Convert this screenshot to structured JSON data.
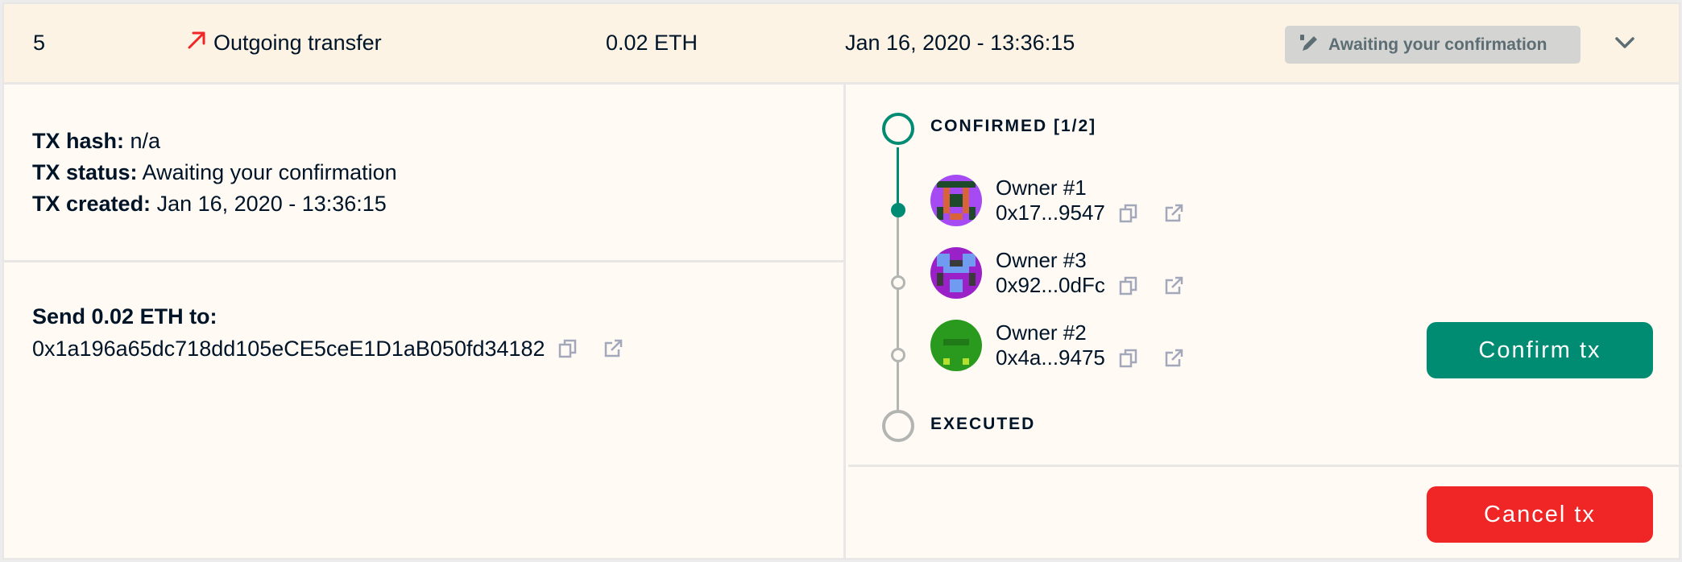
{
  "row": {
    "nonce": "5",
    "type_label": "Outgoing transfer",
    "amount": "0.02 ETH",
    "date": "Jan 16, 2020 - 13:36:15",
    "status": "Awaiting your confirmation",
    "colors": {
      "outgoing_arrow": "#f02525",
      "header_bg": "#fdf3e5",
      "badge_bg": "#d4d5d3"
    }
  },
  "details": {
    "tx_hash_label": "TX hash:",
    "tx_hash_value": "n/a",
    "tx_status_label": "TX status:",
    "tx_status_value": "Awaiting your confirmation",
    "tx_created_label": "TX created:",
    "tx_created_value": "Jan 16, 2020 - 13:36:15",
    "send_title": "Send 0.02 ETH to:",
    "recipient": "0x1a196a65dc718dd105eCE5ceE1D1aB050fd34182"
  },
  "confirmations": {
    "confirmed_label": "CONFIRMED [1/2]",
    "executed_label": "EXECUTED",
    "owners": [
      {
        "name": "Owner #1",
        "address": "0x17...9547",
        "confirmed": true
      },
      {
        "name": "Owner #3",
        "address": "0x92...0dFc",
        "confirmed": false
      },
      {
        "name": "Owner #2",
        "address": "0x4a...9475",
        "confirmed": false
      }
    ],
    "colors": {
      "confirmed": "#008c73",
      "pending": "#b2b5b2"
    }
  },
  "actions": {
    "confirm_label": "Confirm tx",
    "cancel_label": "Cancel tx",
    "colors": {
      "confirm": "#008c73",
      "cancel": "#f02525"
    }
  },
  "icons": [
    "outgoing-arrow-icon",
    "pencil-icon",
    "chevron-down-icon",
    "copy-icon",
    "external-link-icon"
  ]
}
